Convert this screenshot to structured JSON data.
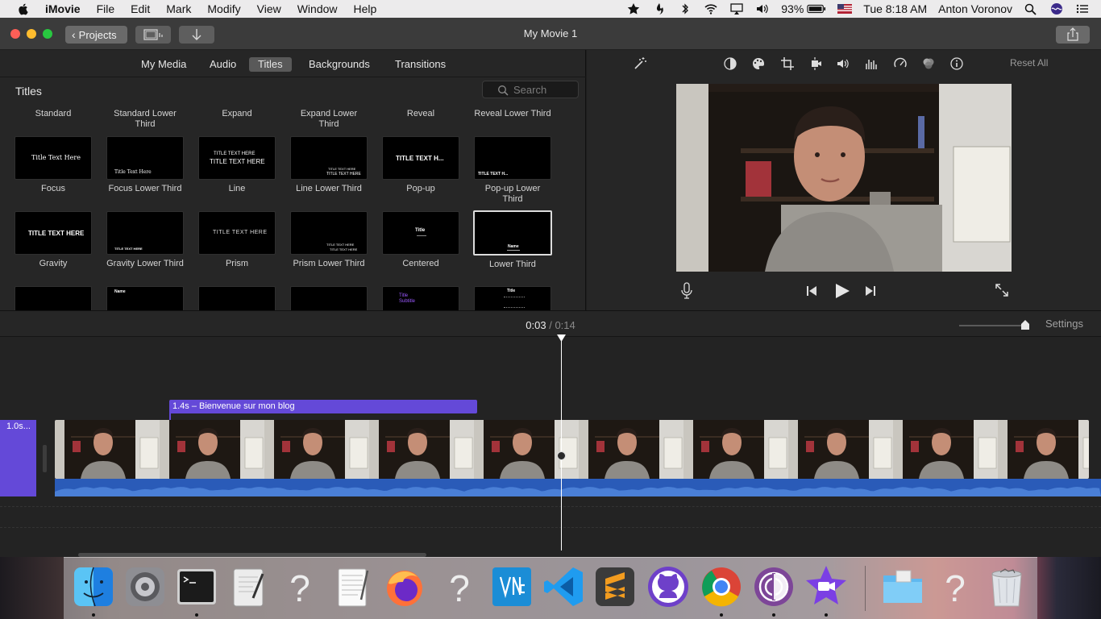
{
  "menubar": {
    "app_name": "iMovie",
    "menus": [
      "File",
      "Edit",
      "Mark",
      "Modify",
      "View",
      "Window",
      "Help"
    ],
    "battery": "93%",
    "clock": "Tue 8:18 AM",
    "user": "Anton Voronov"
  },
  "window": {
    "title": "My Movie 1",
    "projects_button": "Projects"
  },
  "browser": {
    "tabs": [
      "My Media",
      "Audio",
      "Titles",
      "Backgrounds",
      "Transitions"
    ],
    "active_tab": "Titles",
    "section_title": "Titles",
    "search_placeholder": "Search",
    "row0_labels": [
      "Standard",
      "Standard Lower Third",
      "Expand",
      "Expand Lower Third",
      "Reveal",
      "Reveal Lower Third"
    ],
    "tiles": [
      {
        "label": "Focus",
        "preview": "Title Text Here"
      },
      {
        "label": "Focus Lower Third",
        "preview": "Title Text Here"
      },
      {
        "label": "Line",
        "preview": "TITLE TEXT HERE"
      },
      {
        "label": "Line Lower Third",
        "preview": "TITLE TEXT HERE"
      },
      {
        "label": "Pop-up",
        "preview": "TITLE TEXT H..."
      },
      {
        "label": "Pop-up Lower Third",
        "preview": "TITLE TEXT H..."
      },
      {
        "label": "Gravity",
        "preview": "TITLE TEXT HERE"
      },
      {
        "label": "Gravity Lower Third",
        "preview": "TITLE TEXT HERE"
      },
      {
        "label": "Prism",
        "preview": "TITLE TEXT HERE"
      },
      {
        "label": "Prism Lower Third",
        "preview": "TITLE TEXT HERE"
      },
      {
        "label": "Centered",
        "preview": "Title"
      },
      {
        "label": "Lower Third",
        "preview": "Name"
      }
    ],
    "row3_previews": [
      "",
      "Name",
      "",
      "",
      "Title Subtitle",
      "Title"
    ]
  },
  "viewer": {
    "reset_all": "Reset All"
  },
  "timeline": {
    "current_time": "0:03",
    "separator": "/",
    "total_time": "0:14",
    "settings": "Settings",
    "title_clip": "1.4s – Bienvenue sur mon blog",
    "left_clip": "1.0s..."
  },
  "colors": {
    "accent_purple": "#6449d8",
    "audio_blue": "#2a5bb8"
  },
  "dock": [
    "Finder",
    "System Preferences",
    "Terminal",
    "Script Editor",
    "Unknown",
    "TextEdit",
    "Firefox",
    "Unknown",
    "VNC Viewer",
    "Visual Studio Code",
    "Sublime Text",
    "GitHub Desktop",
    "Chrome",
    "Tor Browser",
    "iMovie",
    "Downloads",
    "Unknown",
    "Trash"
  ]
}
